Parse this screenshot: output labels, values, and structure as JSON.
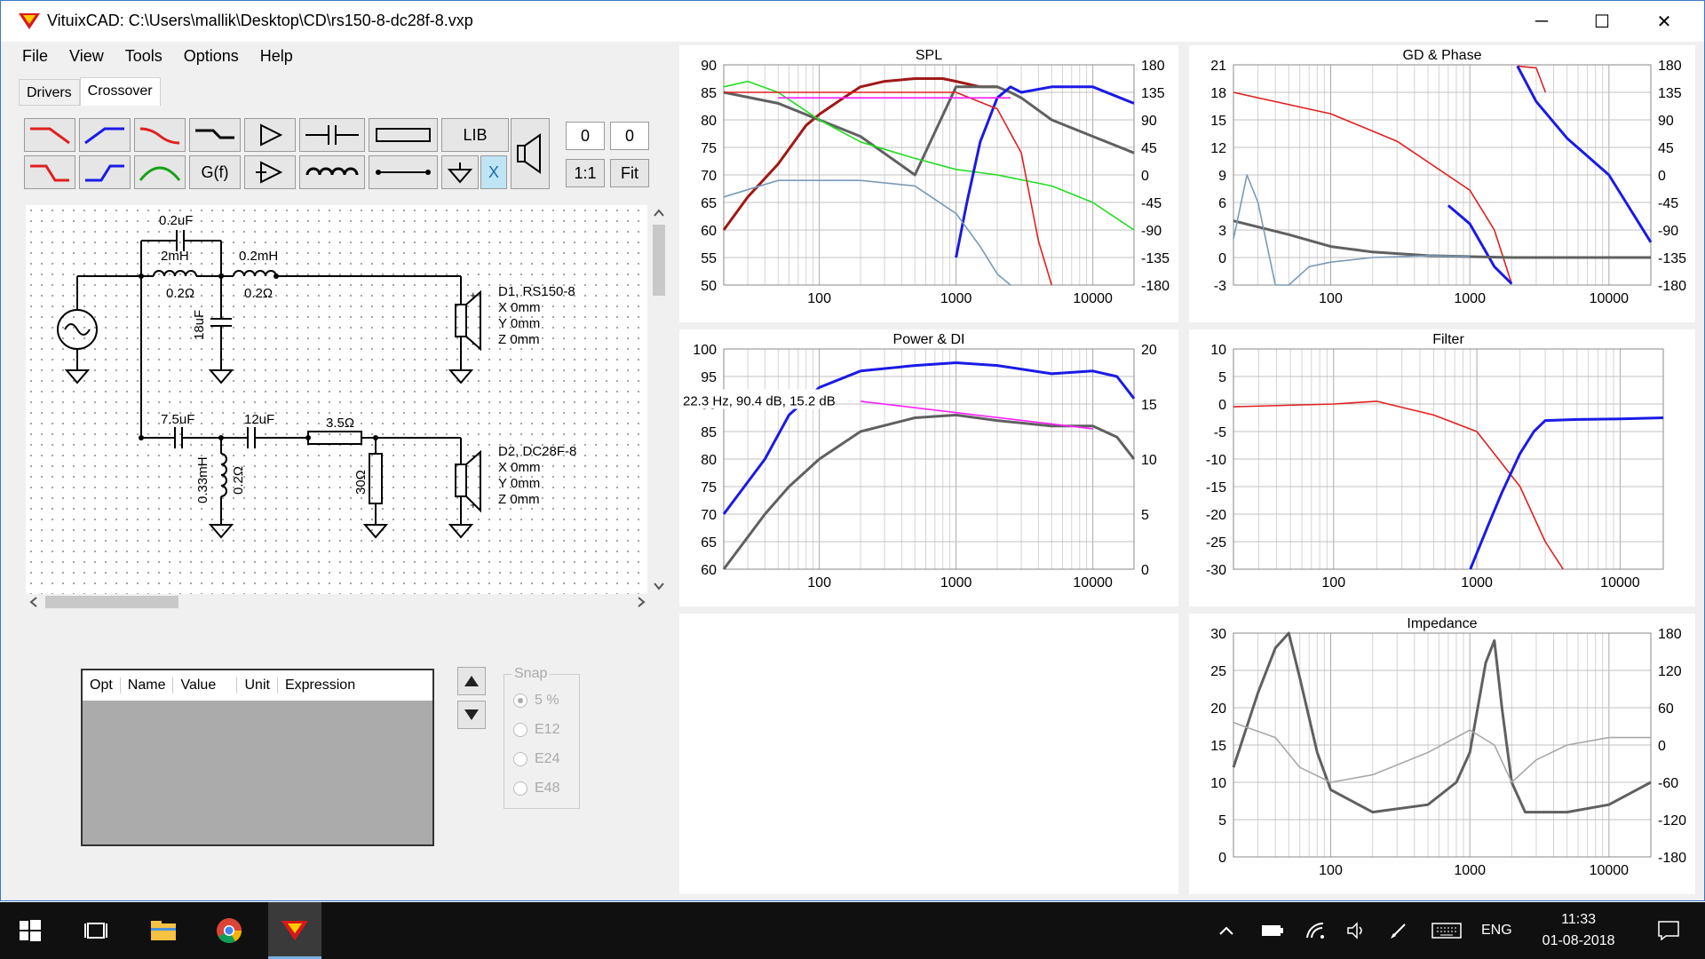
{
  "window": {
    "title": "VituixCAD: C:\\Users\\mallik\\Desktop\\CD\\rs150-8-dc28f-8.vxp",
    "minimize": "─",
    "maximize": "☐",
    "close": "✕"
  },
  "menu": [
    "File",
    "View",
    "Tools",
    "Options",
    "Help"
  ],
  "tabs": [
    "Drivers",
    "Crossover"
  ],
  "toolbar": {
    "lib": "LIB",
    "gf": "G(f)",
    "x": "X",
    "offset_x": "0",
    "offset_y": "0",
    "one_to_one": "1:1",
    "fit": "Fit"
  },
  "schematic": {
    "labels": {
      "c1": "0.2uF",
      "l1": "2mH",
      "r1": "0.2Ω",
      "l2": "0.2mH",
      "r2": "0.2Ω",
      "c2": "18uF",
      "c3": "7.5uF",
      "c4": "12uF",
      "r3": "3.5Ω",
      "l3": "0.33mH",
      "r4": "0.2Ω",
      "r5": "30Ω"
    },
    "driver1": {
      "name": "D1, RS150-8",
      "x": "X 0mm",
      "y": "Y 0mm",
      "z": "Z 0mm"
    },
    "driver2": {
      "name": "D2, DC28F-8",
      "x": "X 0mm",
      "y": "Y 0mm",
      "z": "Z 0mm"
    },
    "plus": "+",
    "minus": "-"
  },
  "options_grid": {
    "columns": [
      "Opt",
      "Name",
      "Value",
      "Unit",
      "Expression"
    ]
  },
  "snap": {
    "legend": "Snap",
    "options": [
      "5 %",
      "E12",
      "E24",
      "E48"
    ],
    "selected": "5 %"
  },
  "taskbar": {
    "time": "11:33",
    "date": "01-08-2018",
    "lang": "ENG"
  },
  "colors": {
    "red": "#e02020",
    "blue": "#1a1ae6",
    "green": "#22dd22",
    "darkred": "#a01818",
    "gray": "#606060",
    "magenta": "#ff20ff",
    "steel": "#7a9ab8"
  },
  "chart_data": [
    {
      "type": "line",
      "title": "SPL",
      "x_scale": "log",
      "xlim": [
        20,
        20000
      ],
      "x_ticks": [
        "100",
        "1000",
        "10000"
      ],
      "y_left_ticks": [
        "90",
        "85",
        "80",
        "75",
        "70",
        "65",
        "60",
        "55",
        "50"
      ],
      "ylim": [
        50,
        90
      ],
      "y_right_ticks": [
        "180",
        "135",
        "90",
        "45",
        "0",
        "-45",
        "-90",
        "-135",
        "-180"
      ],
      "y2lim": [
        -180,
        180
      ],
      "series": [
        {
          "color": "darkred",
          "x": [
            20,
            30,
            50,
            80,
            100,
            150,
            200,
            300,
            500,
            800,
            1000,
            1500,
            2000
          ],
          "values": [
            60,
            66,
            72,
            79,
            81,
            84,
            86,
            87,
            87.5,
            87.5,
            87,
            86,
            86
          ]
        },
        {
          "color": "gray",
          "x": [
            20,
            50,
            100,
            200,
            500,
            1000,
            1500,
            2000,
            2500,
            3000,
            5000,
            10000,
            20000
          ],
          "values": [
            85,
            83,
            80,
            77,
            70,
            86,
            86,
            86,
            85,
            84,
            80,
            77,
            74
          ]
        },
        {
          "color": "green",
          "x": [
            20,
            30,
            50,
            100,
            200,
            500,
            1000,
            2000,
            5000,
            10000,
            20000
          ],
          "values": [
            86,
            87,
            85,
            80,
            76,
            73,
            71,
            70,
            68,
            65,
            60
          ]
        },
        {
          "color": "blue",
          "x": [
            1000,
            1200,
            1500,
            2000,
            2500,
            3000,
            5000,
            10000,
            20000
          ],
          "values": [
            55,
            65,
            76,
            84,
            86,
            85,
            86,
            86,
            83
          ]
        },
        {
          "color": "red",
          "x": [
            20,
            100,
            1000,
            2000,
            3000,
            4000,
            5000
          ],
          "values": [
            85,
            85,
            85,
            82,
            74,
            58,
            50
          ]
        },
        {
          "color": "steel",
          "x": [
            20,
            50,
            100,
            200,
            500,
            1000,
            1500,
            2000,
            2500
          ],
          "values": [
            66,
            69,
            69,
            69,
            68,
            63,
            57,
            52,
            50
          ]
        },
        {
          "color": "magenta",
          "x": [
            50,
            2500
          ],
          "values": [
            84,
            84
          ]
        }
      ]
    },
    {
      "type": "line",
      "title": "GD & Phase",
      "x_scale": "log",
      "xlim": [
        20,
        20000
      ],
      "x_ticks": [
        "100",
        "1000",
        "10000"
      ],
      "y_left_ticks": [
        "21",
        "18",
        "15",
        "12",
        "9",
        "6",
        "3",
        "0",
        "-3"
      ],
      "ylim": [
        -3,
        21
      ],
      "y_right_ticks": [
        "180",
        "135",
        "90",
        "45",
        "0",
        "-45",
        "-90",
        "-135",
        "-180"
      ],
      "y2lim": [
        -180,
        180
      ],
      "series": [
        {
          "color": "red",
          "axis": "right",
          "x": [
            20,
            100,
            300,
            1000,
            1500,
            2000,
            2200,
            3000,
            3500
          ],
          "values": [
            135,
            100,
            55,
            -25,
            -90,
            -178,
            178,
            175,
            135
          ]
        },
        {
          "color": "blue",
          "axis": "right",
          "x": [
            700,
            1000,
            1500,
            2000,
            2200,
            3000,
            5000,
            10000,
            20000
          ],
          "values": [
            -50,
            -80,
            -150,
            -178,
            178,
            120,
            60,
            0,
            -110
          ]
        },
        {
          "color": "gray",
          "axis": "left",
          "x": [
            20,
            50,
            100,
            200,
            500,
            1000,
            2000,
            5000,
            20000
          ],
          "values": [
            4,
            2.5,
            1.2,
            0.6,
            0.2,
            0.1,
            0,
            0,
            0
          ]
        },
        {
          "color": "steel",
          "axis": "left",
          "x": [
            20,
            25,
            30,
            40,
            50,
            70,
            100,
            200,
            500,
            1000
          ],
          "values": [
            2,
            9,
            6,
            -3,
            -3,
            -1,
            -0.5,
            0,
            0.2,
            0.1
          ]
        }
      ]
    },
    {
      "type": "line",
      "title": "Power & DI",
      "x_scale": "log",
      "xlim": [
        20,
        20000
      ],
      "x_ticks": [
        "100",
        "1000",
        "10000"
      ],
      "y_left_ticks": [
        "100",
        "95",
        "90",
        "85",
        "80",
        "75",
        "70",
        "65",
        "60"
      ],
      "ylim": [
        60,
        100
      ],
      "y_right_ticks": [
        "20",
        "15",
        "10",
        "5",
        "0"
      ],
      "y2lim": [
        0,
        20
      ],
      "annotation": "22.3 Hz, 90.4 dB, 15.2 dB",
      "series": [
        {
          "color": "blue",
          "x": [
            20,
            40,
            60,
            100,
            200,
            500,
            1000,
            2000,
            5000,
            10000,
            15000,
            20000
          ],
          "values": [
            70,
            80,
            88,
            93,
            96,
            97,
            97.5,
            97,
            95.5,
            96,
            95,
            91
          ]
        },
        {
          "color": "gray",
          "x": [
            20,
            40,
            60,
            100,
            200,
            500,
            1000,
            2000,
            5000,
            10000,
            15000,
            20000
          ],
          "values": [
            60,
            70,
            75,
            80,
            85,
            87.5,
            88,
            87,
            86,
            86,
            84,
            80
          ]
        },
        {
          "color": "magenta",
          "x": [
            200,
            10000
          ],
          "values": [
            90.5,
            85.5
          ]
        }
      ]
    },
    {
      "type": "line",
      "title": "Filter",
      "x_scale": "log",
      "xlim": [
        20,
        20000
      ],
      "x_ticks": [
        "100",
        "1000",
        "10000"
      ],
      "y_left_ticks": [
        "10",
        "5",
        "0",
        "-5",
        "-10",
        "-15",
        "-20",
        "-25",
        "-30"
      ],
      "ylim": [
        -30,
        10
      ],
      "series": [
        {
          "color": "red",
          "x": [
            20,
            100,
            200,
            500,
            1000,
            2000,
            3000,
            4000
          ],
          "values": [
            -0.5,
            0,
            0.5,
            -2,
            -5,
            -15,
            -25,
            -30
          ]
        },
        {
          "color": "blue",
          "x": [
            900,
            1200,
            1500,
            2000,
            2500,
            3000,
            5000,
            10000,
            20000
          ],
          "values": [
            -30,
            -22,
            -16,
            -9,
            -5,
            -3,
            -2.8,
            -2.7,
            -2.5
          ]
        }
      ]
    },
    {
      "type": "line",
      "title": "Impedance",
      "x_scale": "log",
      "xlim": [
        20,
        20000
      ],
      "x_ticks": [
        "100",
        "1000",
        "10000"
      ],
      "y_left_ticks": [
        "30",
        "25",
        "20",
        "15",
        "10",
        "5",
        "0"
      ],
      "ylim": [
        0,
        30
      ],
      "y_right_ticks": [
        "180",
        "120",
        "60",
        "0",
        "-60",
        "-120",
        "-180"
      ],
      "y2lim": [
        -180,
        180
      ],
      "series": [
        {
          "color": "gray",
          "axis": "left",
          "x": [
            20,
            30,
            40,
            50,
            60,
            80,
            100,
            200,
            500,
            800,
            1000,
            1300,
            1500,
            1700,
            2000,
            2500,
            5000,
            10000,
            20000
          ],
          "values": [
            12,
            22,
            28,
            30,
            24,
            14,
            9,
            6,
            7,
            10,
            14,
            26,
            29,
            20,
            10,
            6,
            6,
            7,
            10
          ]
        },
        {
          "color": "lightgray",
          "axis": "left",
          "x": [
            20,
            40,
            60,
            100,
            200,
            500,
            1000,
            1500,
            2000,
            3000,
            5000,
            10000,
            20000
          ],
          "values": [
            18,
            16,
            12,
            10,
            11,
            14,
            17,
            15,
            10,
            13,
            15,
            16,
            16
          ]
        }
      ]
    }
  ]
}
